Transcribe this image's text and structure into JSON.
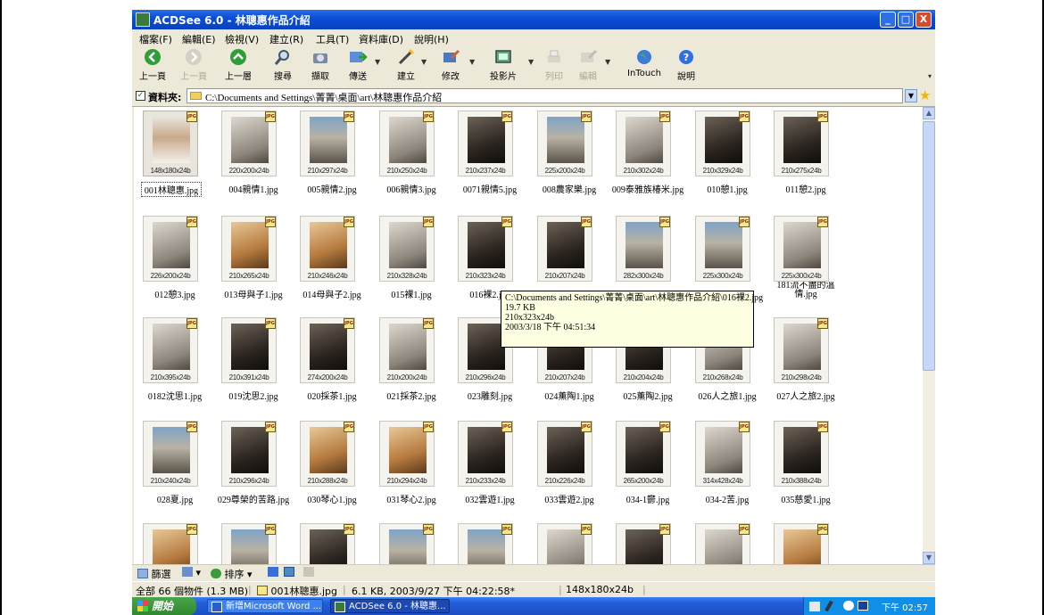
{
  "window": {
    "title": "ACDSee 6.0 - 林聰惠作品介紹",
    "controls": {
      "minimize": "_",
      "maximize": "□",
      "close": "X"
    }
  },
  "menu": [
    "檔案(F)",
    "編輯(E)",
    "檢視(V)",
    "建立(R)",
    "工具(T)",
    "資料庫(D)",
    "說明(H)"
  ],
  "toolbar": {
    "items": [
      {
        "label": "上一頁",
        "icon": "back-icon",
        "enabled": true
      },
      {
        "label": "上一頁",
        "icon": "forward-icon",
        "enabled": false
      },
      {
        "label": "上一層",
        "icon": "up-icon",
        "enabled": true
      },
      {
        "label": "搜尋",
        "icon": "search-icon",
        "enabled": true
      },
      {
        "label": "擷取",
        "icon": "acquire-icon",
        "enabled": true
      },
      {
        "label": "傳送",
        "icon": "send-icon",
        "enabled": true
      },
      {
        "label": "建立",
        "icon": "create-icon",
        "enabled": true
      },
      {
        "label": "修改",
        "icon": "edit-icon",
        "enabled": true
      },
      {
        "label": "投影片",
        "icon": "slideshow-icon",
        "enabled": true
      },
      {
        "label": "列印",
        "icon": "print-icon",
        "enabled": false
      },
      {
        "label": "編輯",
        "icon": "edit-image-icon",
        "enabled": false
      },
      {
        "label": "InTouch",
        "icon": "globe-icon",
        "enabled": true
      },
      {
        "label": "說明",
        "icon": "help-icon",
        "enabled": true
      }
    ]
  },
  "address": {
    "label": "資料夾:",
    "path": "C:\\Documents and Settings\\菁菁\\桌面\\art\\林聰惠作品介紹"
  },
  "thumbnails": [
    {
      "name": "001林聰惠.jpg",
      "dims": "148x180x24b",
      "selected": true
    },
    {
      "name": "004親情1.jpg",
      "dims": "220x200x24b"
    },
    {
      "name": "005親情2.jpg",
      "dims": "210x297x24b"
    },
    {
      "name": "006親情3.jpg",
      "dims": "210x250x24b"
    },
    {
      "name": "0071親情5.jpg",
      "dims": "210x237x24b"
    },
    {
      "name": "008農家樂.jpg",
      "dims": "225x200x24b"
    },
    {
      "name": "009泰雅族椿米.jpg",
      "dims": "210x302x24b"
    },
    {
      "name": "010憩1.jpg",
      "dims": "210x329x24b"
    },
    {
      "name": "011憩2.jpg",
      "dims": "210x275x24b"
    },
    {
      "name": "012憩3.jpg",
      "dims": "226x200x24b"
    },
    {
      "name": "013母與子1.jpg",
      "dims": "210x265x24b"
    },
    {
      "name": "014母與子2.jpg",
      "dims": "210x246x24b"
    },
    {
      "name": "015裸1.jpg",
      "dims": "210x328x24b"
    },
    {
      "name": "016裸2.jpg",
      "dims": "210x323x24b"
    },
    {
      "name": "",
      "dims": "210x207x24b"
    },
    {
      "name": "",
      "dims": "282x300x24b"
    },
    {
      "name": "",
      "dims": "225x300x24b"
    },
    {
      "name": "181流不盡的溫情.jpg",
      "dims": "225x300x24b"
    },
    {
      "name": "0182沈思1.jpg",
      "dims": "210x395x24b"
    },
    {
      "name": "019沈思2.jpg",
      "dims": "210x391x24b"
    },
    {
      "name": "020採茶1.jpg",
      "dims": "274x200x24b"
    },
    {
      "name": "021採茶2.jpg",
      "dims": "210x200x24b"
    },
    {
      "name": "023雕刻.jpg",
      "dims": "210x296x24b"
    },
    {
      "name": "024薰陶1.jpg",
      "dims": "210x207x24b"
    },
    {
      "name": "025薰陶2.jpg",
      "dims": "210x204x24b"
    },
    {
      "name": "026人之旅1.jpg",
      "dims": "210x268x24b"
    },
    {
      "name": "027人之旅2.jpg",
      "dims": "210x298x24b"
    },
    {
      "name": "028夏.jpg",
      "dims": "210x240x24b"
    },
    {
      "name": "029尊榮的苦路.jpg",
      "dims": "210x296x24b"
    },
    {
      "name": "030琴心1.jpg",
      "dims": "210x288x24b"
    },
    {
      "name": "031琴心2.jpg",
      "dims": "210x294x24b"
    },
    {
      "name": "032雲遊1.jpg",
      "dims": "210x233x24b"
    },
    {
      "name": "033雲遊2.jpg",
      "dims": "210x226x24b"
    },
    {
      "name": "034-1鬱.jpg",
      "dims": "265x200x24b"
    },
    {
      "name": "034-2苦.jpg",
      "dims": "314x428x24b"
    },
    {
      "name": "035慈愛1.jpg",
      "dims": "210x388x24b"
    },
    {
      "name": "",
      "dims": ""
    },
    {
      "name": "",
      "dims": ""
    },
    {
      "name": "",
      "dims": ""
    },
    {
      "name": "",
      "dims": ""
    },
    {
      "name": "",
      "dims": ""
    },
    {
      "name": "",
      "dims": ""
    },
    {
      "name": "",
      "dims": ""
    },
    {
      "name": "",
      "dims": ""
    },
    {
      "name": "",
      "dims": ""
    }
  ],
  "badge_text": "JPG",
  "tooltip": {
    "path": "C:\\Documents and Settings\\菁菁\\桌面\\art\\林聰惠作品介紹\\016裸2.jpg",
    "size": "19.7 KB",
    "dims": "210x323x24b",
    "date": "2003/3/18 下午 04:51:34"
  },
  "filterbar": {
    "filter": "篩選",
    "sort": "排序"
  },
  "status": {
    "total": "全部 66 個物件 (1.3 MB)",
    "file": "001林聰惠.jpg",
    "info": "6.1 KB, 2003/9/27 下午 04:22:58*",
    "dims": "148x180x24b"
  },
  "taskbar": {
    "start": "開始",
    "tasks": [
      "新增Microsoft Word ...",
      "ACDSee 6.0 - 林聰惠..."
    ],
    "time": "下午 02:57"
  },
  "colors": {
    "titlebar": "#0a4ed8",
    "taskbar": "#245edb",
    "tooltip_bg": "#ffffe1",
    "start": "#2e8a2e"
  }
}
